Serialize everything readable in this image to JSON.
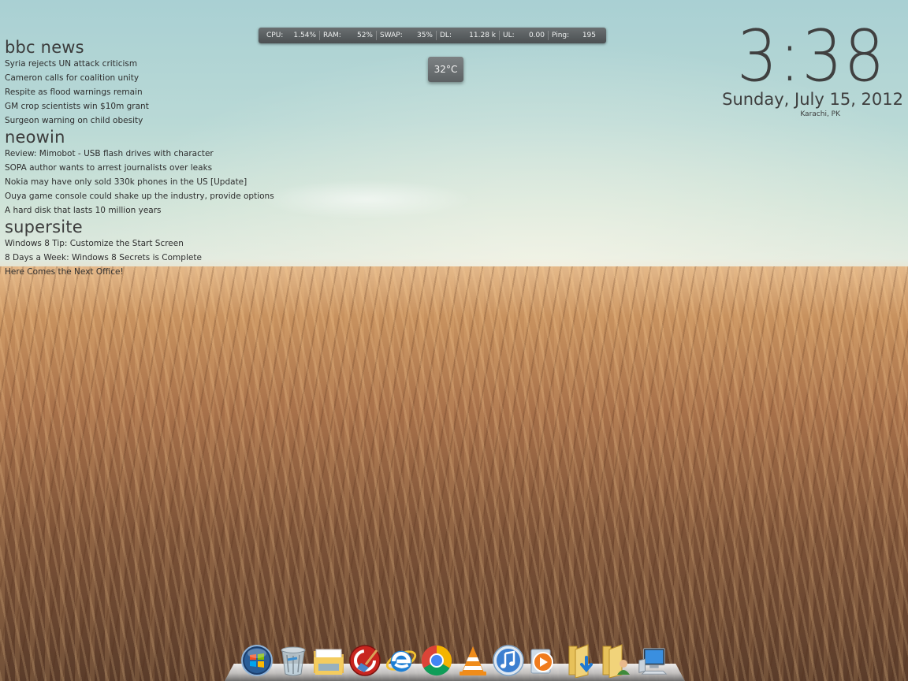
{
  "news": {
    "groups": [
      {
        "title": "bbc news",
        "items": [
          "Syria rejects UN attack criticism",
          "Cameron calls for coalition unity",
          "Respite as flood warnings remain",
          "GM crop scientists win $10m grant",
          "Surgeon warning on child obesity"
        ]
      },
      {
        "title": "neowin",
        "items": [
          "Review: Mimobot - USB flash drives with character",
          "SOPA author wants to arrest journalists over leaks",
          "Nokia may have only sold 330k phones in the US [Update]",
          "Ouya game console could shake up the industry, provide options",
          "A hard disk that lasts 10 million years"
        ]
      },
      {
        "title": "supersite",
        "items": [
          "Windows 8 Tip: Customize the Start Screen",
          "8 Days a Week: Windows 8 Secrets is Complete",
          "Here Comes the Next Office!"
        ]
      }
    ]
  },
  "stats": {
    "cpu": {
      "label": "CPU:",
      "value": "1.54%"
    },
    "ram": {
      "label": "RAM:",
      "value": "52%"
    },
    "swap": {
      "label": "SWAP:",
      "value": "35%"
    },
    "dl": {
      "label": "DL:",
      "value": "11.28 k"
    },
    "ul": {
      "label": "UL:",
      "value": "0.00"
    },
    "ping": {
      "label": "Ping:",
      "value": "195"
    }
  },
  "weather": {
    "temperature": "32°C"
  },
  "clock": {
    "time": "3:38",
    "date": "Sunday, July 15, 2012",
    "location": "Karachi, PK"
  },
  "dock": {
    "icons": [
      "windows-start-icon",
      "recycle-bin-icon",
      "file-explorer-icon",
      "ccleaner-icon",
      "internet-explorer-icon",
      "google-chrome-icon",
      "vlc-player-icon",
      "itunes-icon",
      "media-player-icon",
      "downloads-folder-icon",
      "user-folder-icon",
      "computer-icon"
    ]
  },
  "colors": {
    "widget_bg": "#4b5052",
    "text_dark": "#3a3a3a"
  }
}
